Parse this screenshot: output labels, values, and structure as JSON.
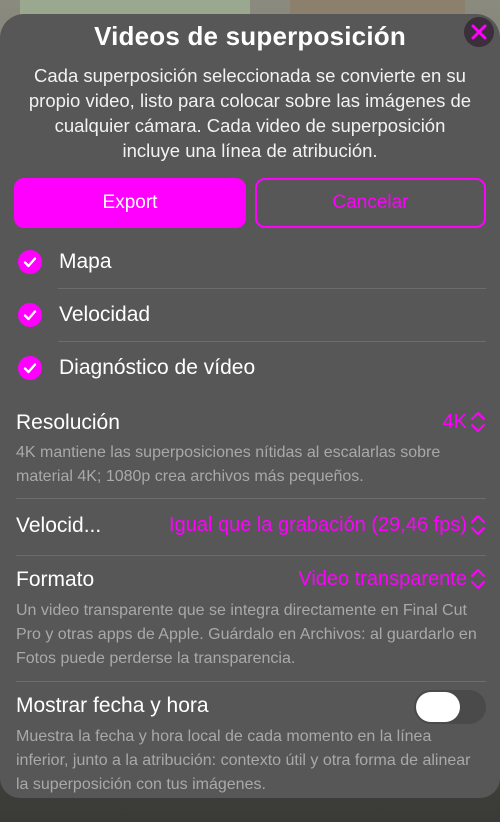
{
  "title": "Videos de superposición",
  "description": "Cada superposición seleccionada se convierte en su propio video, listo para colocar sobre las imágenes de cualquier cámara. Cada video de superposición incluye una línea de atribución.",
  "buttons": {
    "export": "Export",
    "cancel": "Cancelar"
  },
  "overlays": [
    {
      "label": "Mapa",
      "checked": true
    },
    {
      "label": "Velocidad",
      "checked": true
    },
    {
      "label": "Diagnóstico de vídeo",
      "checked": true
    }
  ],
  "settings": {
    "resolution": {
      "label": "Resolución",
      "value": "4K",
      "help": "4K mantiene las superposiciones nítidas al escalarlas sobre material 4K; 1080p crea archivos más pequeños."
    },
    "framerate": {
      "label": "Velocid...",
      "value": "Igual que la grabación (29,46 fps)"
    },
    "format": {
      "label": "Formato",
      "value": "Video transparente",
      "help": "Un video transparente que se integra directamente en Final Cut Pro y otras apps de Apple. Guárdalo en Archivos: al guardarlo en Fotos puede perderse la transparencia."
    },
    "datetime": {
      "label": "Mostrar fecha y hora",
      "enabled": false,
      "help": "Muestra la fecha y hora local de cada momento en la línea inferior, junto a la atribución: contexto útil y otra forma de alinear la superposición con tus imágenes."
    }
  },
  "colors": {
    "accent": "#ff00ff",
    "sheet": "#575757",
    "help_text": "#a9a9a9"
  }
}
